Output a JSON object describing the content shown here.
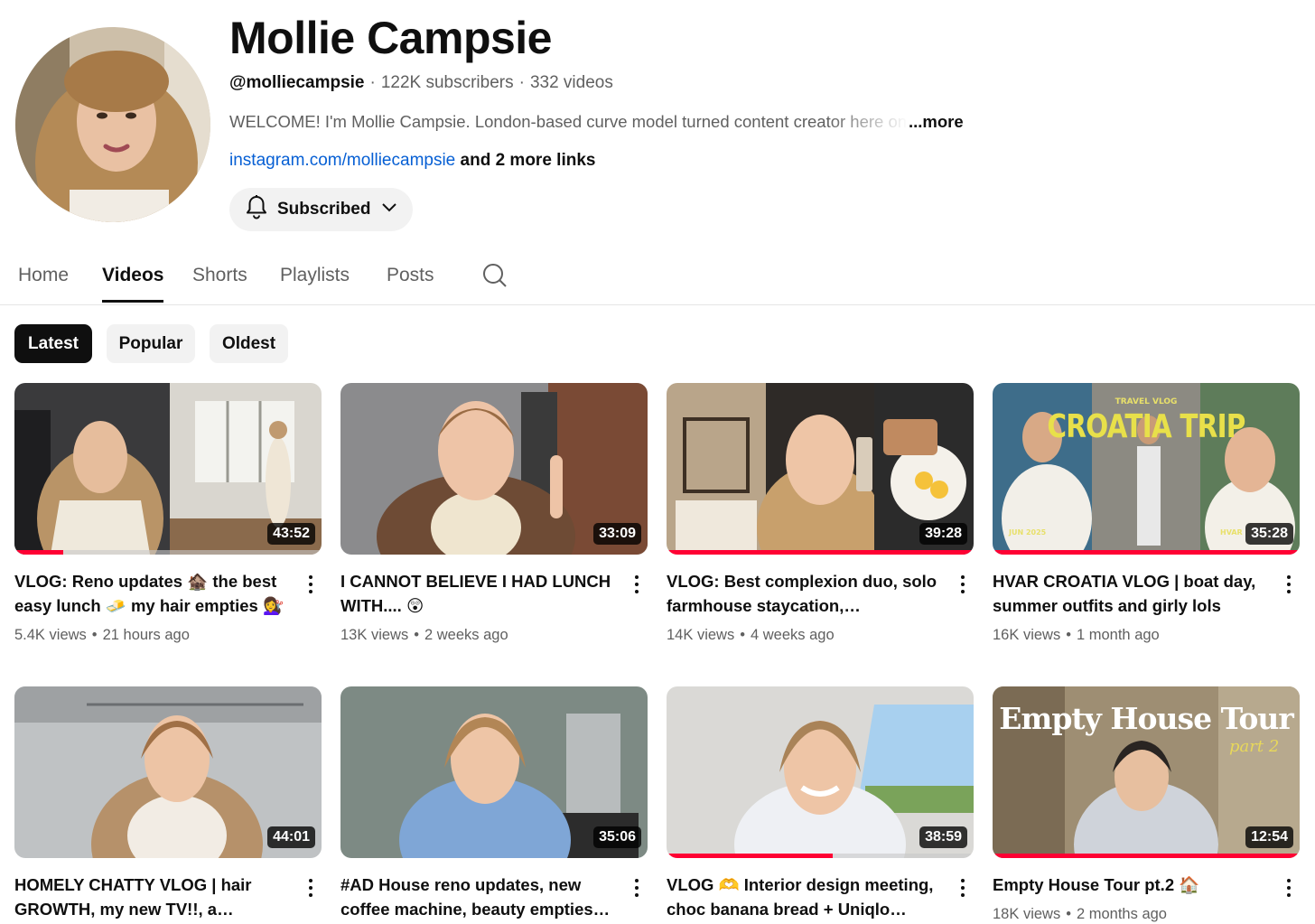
{
  "channel": {
    "name": "Mollie Campsie",
    "handle": "@molliecampsie",
    "subscribers": "122K subscribers",
    "videos_count": "332 videos",
    "description": "WELCOME! I'm Mollie Campsie. London-based curve model turned content creator here on",
    "more_label": "...more",
    "link": "instagram.com/molliecampsie",
    "extra_links": " and 2 more links",
    "subscribe_label": "Subscribed"
  },
  "tabs": [
    {
      "label": "Home"
    },
    {
      "label": "Videos"
    },
    {
      "label": "Shorts"
    },
    {
      "label": "Playlists"
    },
    {
      "label": "Posts"
    }
  ],
  "chips": [
    {
      "label": "Latest"
    },
    {
      "label": "Popular"
    },
    {
      "label": "Oldest"
    }
  ],
  "videos": [
    {
      "title": "VLOG: Reno updates 🏚️ the best easy lunch 🧈 my hair empties 💇‍♀️",
      "duration": "43:52",
      "views": "5.4K views",
      "age": "21 hours ago",
      "progress": 0.16
    },
    {
      "title": "I CANNOT BELIEVE I HAD LUNCH WITH.... 😲",
      "duration": "33:09",
      "views": "13K views",
      "age": "2 weeks ago",
      "progress": 0
    },
    {
      "title": "VLOG: Best complexion duo, solo farmhouse staycation, unbeatable…",
      "duration": "39:28",
      "views": "14K views",
      "age": "4 weeks ago",
      "progress": 1.0
    },
    {
      "title": "HVAR CROATIA VLOG | boat day, summer outfits and girly lols",
      "duration": "35:28",
      "views": "16K views",
      "age": "1 month ago",
      "progress": 1.0,
      "overlay": {
        "top": "TRAVEL VLOG",
        "main": "CROATIA TRIP",
        "left": "JUN 2025",
        "right": "HVAR"
      }
    },
    {
      "title": "HOMELY CHATTY VLOG | hair GROWTH, my new TV!!, a seriously…",
      "duration": "44:01",
      "views": "",
      "age": "",
      "progress": 0
    },
    {
      "title": "#AD House reno updates, new coffee machine, beauty empties +…",
      "duration": "35:06",
      "views": "",
      "age": "",
      "progress": 0
    },
    {
      "title": "VLOG 🫶 Interior design meeting, choc banana bread + Uniqlo…",
      "duration": "38:59",
      "views": "",
      "age": "",
      "progress": 0.54
    },
    {
      "title": "Empty House Tour pt.2 🏠",
      "duration": "12:54",
      "views": "18K views",
      "age": "2 months ago",
      "progress": 1.0,
      "overlay": {
        "main": "Empty House Tour",
        "script": "part 2"
      }
    }
  ],
  "colors": {
    "accent_red": "#ff0033",
    "link_blue": "#065fd4",
    "text_primary": "#0f0f0f",
    "text_secondary": "#606060"
  },
  "icons": {
    "bell": "bell-icon",
    "chevron": "chevron-down-icon",
    "search": "search-icon",
    "more": "more-vertical-icon"
  }
}
